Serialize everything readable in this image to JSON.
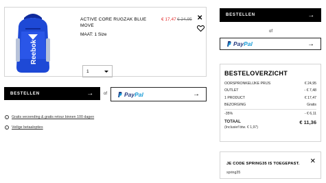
{
  "product": {
    "name": "ACTIVE CORE RUGZAK BLUE MOVE",
    "size": "MAAT: 1 Size",
    "sale_price": "€ 17,47",
    "original_price": "€ 24,95",
    "quantity": "1",
    "brand_print": "Reebok",
    "colors": {
      "bag": "#1e49d6",
      "bag_dark": "#0f2a9b"
    }
  },
  "actions": {
    "order_label": "BESTELLEN",
    "or_label": "of",
    "arrow": "→",
    "paypal_part1": "Pay",
    "paypal_part2": "Pal"
  },
  "info": {
    "shipping_link": "Gratis verzending & gratis retour binnen 100 dagen",
    "payment_link": "Veilige betaalopties",
    "icon": "info-circle-icon"
  },
  "summary": {
    "title": "BESTELOVERZICHT",
    "rows": [
      {
        "label": "OORSPRONKELIJKE PRIJS",
        "value": "€ 24,95"
      },
      {
        "label": "OUTLET",
        "value": "- € 7,48"
      },
      {
        "label": "1 PRODUCT",
        "value": "€ 17,47"
      },
      {
        "label": "BEZORGING",
        "value": "Gratis"
      },
      {
        "label": "-35%",
        "value": "- € 6,11"
      }
    ],
    "total_label": "TOTAAL",
    "total_value": "€ 11,36",
    "vat_note": "(Inclusief btw. € 1,97)"
  },
  "promo": {
    "title": "JE CODE SPRING35 IS TOEGEPAST.",
    "code": "spring35"
  },
  "colors": {
    "sale_red": "#e32b2b",
    "paypal_dark": "#253b80",
    "paypal_light": "#179bd7"
  }
}
